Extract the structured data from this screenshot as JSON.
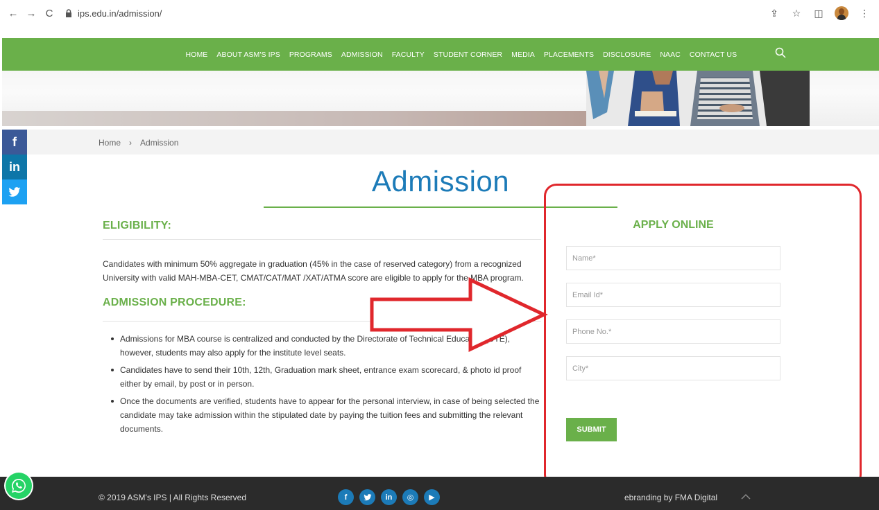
{
  "browser": {
    "url": "ips.edu.in/admission/",
    "back": "←",
    "forward": "→",
    "reload": "C",
    "share_icon": "⇪",
    "star_icon": "☆",
    "sidepanel_icon": "◫",
    "menu_icon": "⋮"
  },
  "nav": {
    "items": [
      "HOME",
      "ABOUT ASM's IPS",
      "PROGRAMS",
      "ADMISSION",
      "FACULTY",
      "STUDENT CORNER",
      "MEDIA",
      "PLACEMENTS",
      "DISCLOSURE",
      "NAAC",
      "CONTACT US"
    ],
    "accent": "#6ab04a"
  },
  "social_side": {
    "facebook": "f",
    "linkedin": "in",
    "twitter": "t"
  },
  "breadcrumb": {
    "home": "Home",
    "sep": "›",
    "current": "Admission"
  },
  "page_title": "Admission",
  "eligibility": {
    "heading": "ELIGIBILITY:",
    "text": "Candidates with minimum 50% aggregate in graduation (45% in the case of reserved category) from a recognized University with valid MAH-MBA-CET, CMAT/CAT/MAT /XAT/ATMA score are eligible to apply for the MBA program."
  },
  "procedure": {
    "heading": "ADMISSION PROCEDURE:",
    "items": [
      "Admissions for MBA course is centralized and conducted by the Directorate of Technical Education (DTE), however, students may also apply for the institute level seats.",
      "Candidates have to send their 10th, 12th, Graduation mark sheet, entrance exam scorecard, & photo id proof either by email, by post or in person.",
      "Once the documents are verified, students have to appear for the personal interview, in case of being selected the candidate may take admission within the stipulated date by paying the tuition fees and submitting the relevant documents."
    ]
  },
  "apply_form": {
    "title": "APPLY ONLINE",
    "name_placeholder": "Name*",
    "email_placeholder": "Email Id*",
    "phone_placeholder": "Phone No.*",
    "city_placeholder": "City*",
    "submit_label": "SUBMIT"
  },
  "annotation_color": "#e0272c",
  "footer": {
    "copyright": "© 2019 ASM's IPS | All Rights Reserved",
    "social": [
      "f",
      "t",
      "in",
      "◎",
      "▶"
    ],
    "ebranding": "ebranding by FMA Digital"
  }
}
